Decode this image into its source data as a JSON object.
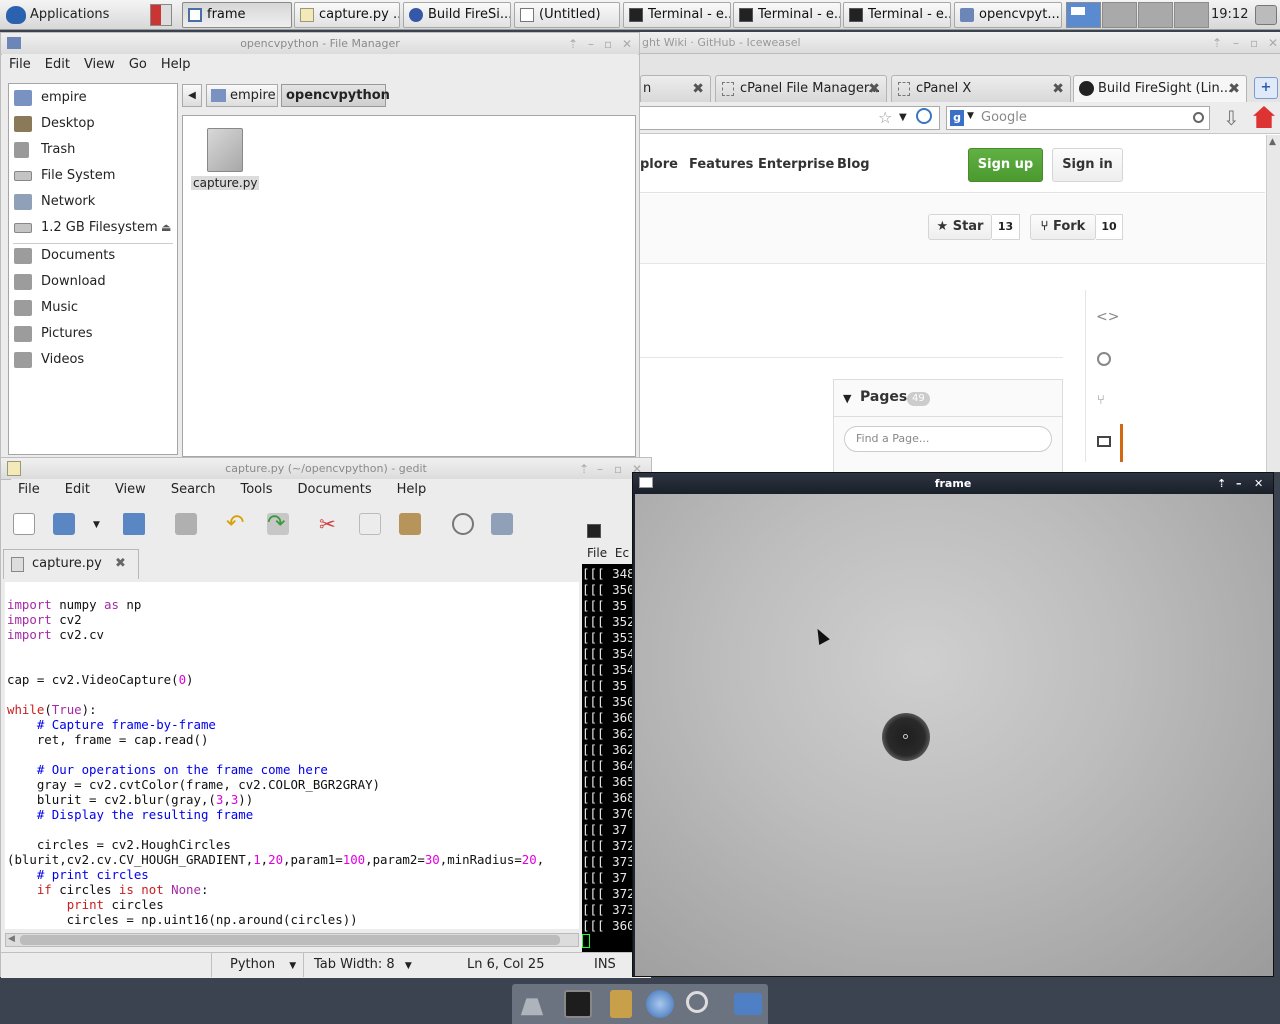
{
  "panel": {
    "apps_menu": "Applications Menu",
    "tasks": [
      {
        "label": "frame",
        "icon": "window-icon"
      },
      {
        "label": "capture.py ...",
        "icon": "text-editor-icon"
      },
      {
        "label": "Build FireSi...",
        "icon": "browser-icon"
      },
      {
        "label": "(Untitled)",
        "icon": "document-icon"
      },
      {
        "label": "Terminal - e...",
        "icon": "terminal-icon"
      },
      {
        "label": "Terminal - e...",
        "icon": "terminal-icon"
      },
      {
        "label": "Terminal - e...",
        "icon": "terminal-icon"
      },
      {
        "label": "opencvpyt...",
        "icon": "folder-icon"
      }
    ],
    "clock": "19:12"
  },
  "file_manager": {
    "title": "opencvpython - File Manager",
    "menu": [
      "File",
      "Edit",
      "View",
      "Go",
      "Help"
    ],
    "path": [
      "empire",
      "opencvpython"
    ],
    "sidebar": [
      {
        "label": "empire",
        "icon": "home-folder-icon"
      },
      {
        "label": "Desktop",
        "icon": "desktop-icon"
      },
      {
        "label": "Trash",
        "icon": "trash-icon"
      },
      {
        "label": "File System",
        "icon": "drive-icon"
      },
      {
        "label": "Network",
        "icon": "network-icon"
      },
      {
        "label": "1.2 GB Filesystem",
        "icon": "drive-icon"
      },
      {
        "label": "Documents",
        "icon": "folder-icon"
      },
      {
        "label": "Download",
        "icon": "folder-icon"
      },
      {
        "label": "Music",
        "icon": "music-folder-icon"
      },
      {
        "label": "Pictures",
        "icon": "pictures-folder-icon"
      },
      {
        "label": "Videos",
        "icon": "videos-folder-icon"
      }
    ],
    "files": [
      {
        "name": "capture.py",
        "icon": "python-file-icon"
      }
    ]
  },
  "browser": {
    "title": "ght Wiki · GitHub - Iceweasel",
    "tabs": [
      {
        "label": "n"
      },
      {
        "label": "cPanel File Manager..."
      },
      {
        "label": "cPanel X"
      },
      {
        "label": "Build FireSight (Lin..."
      }
    ],
    "search_placeholder": "Google",
    "nav": [
      "plore",
      "Features",
      "Enterprise",
      "Blog"
    ],
    "signup": "Sign up",
    "signin": "Sign in",
    "star_label": "Star",
    "star_count": "13",
    "fork_label": "Fork",
    "fork_count": "10",
    "pages_label": "Pages",
    "pages_count": "49",
    "find_page_placeholder": "Find a Page..."
  },
  "gedit": {
    "title": "capture.py (~/opencvpython) - gedit",
    "menu": [
      "File",
      "Edit",
      "View",
      "Search",
      "Tools",
      "Documents",
      "Help"
    ],
    "tab": "capture.py",
    "status_lang": "Python",
    "status_tab": "Tab Width:  8",
    "status_pos": "Ln 6, Col 25",
    "status_mode": "INS"
  },
  "terminal": {
    "menu": [
      "File",
      "Ec"
    ],
    "lines": [
      "[[[ 348",
      "[[[ 350",
      "[[[ 35",
      "[[[ 352",
      "[[[ 353",
      "[[[ 354",
      "[[[ 354",
      "[[[ 35",
      "[[[ 350",
      "[[[ 360",
      "[[[ 362",
      "[[[ 362",
      "[[[ 364",
      "[[[ 365",
      "[[[ 368",
      "[[[ 370",
      "[[[ 37",
      "[[[ 372",
      "[[[ 373",
      "[[[ 37",
      "[[[ 372",
      "[[[ 373",
      "[[[ 360"
    ]
  },
  "frame_window": {
    "title": "frame"
  }
}
